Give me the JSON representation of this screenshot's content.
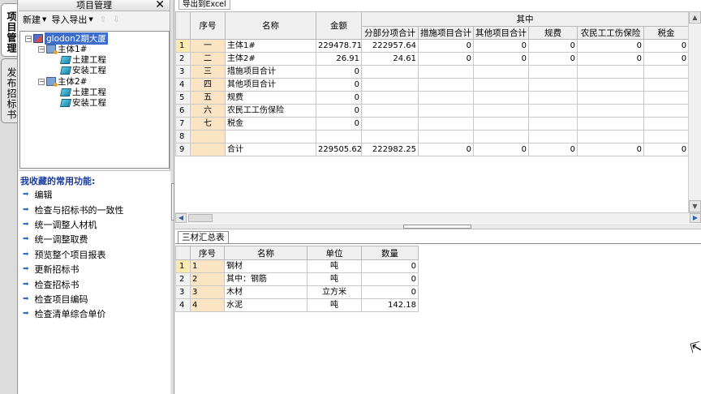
{
  "vertical_tabs": [
    "项目管理",
    "发布招标书"
  ],
  "left_panel": {
    "title": "项目管理",
    "close_glyph": "✕",
    "toolbar": {
      "new_label": "新建",
      "import_export_label": "导入导出",
      "up_glyph": "⇧",
      "down_glyph": "⇩"
    },
    "tree": {
      "root": "glodon2期大厦",
      "nodes": [
        {
          "label": "主体1#",
          "children": [
            "土建工程",
            "安装工程"
          ]
        },
        {
          "label": "主体2#",
          "children": [
            "土建工程",
            "安装工程"
          ]
        }
      ]
    },
    "favorites": {
      "title": "我收藏的常用功能:",
      "items": [
        "编辑",
        "检查与招标书的一致性",
        "统一调整人材机",
        "统一调整取费",
        "预览整个项目报表",
        "更新招标书",
        "检查招标书",
        "检查项目编码",
        "检查清单综合单价"
      ]
    }
  },
  "main": {
    "export_tab": "导出到Excel",
    "headers": {
      "seq": "序号",
      "name": "名称",
      "amount": "金额",
      "group": "其中",
      "sub": [
        "分部分项合计",
        "措施项目合计",
        "其他项目合计",
        "规费",
        "农民工工伤保险",
        "税金"
      ]
    },
    "rows": [
      {
        "n": "1",
        "seq": "一",
        "name": "主体1#",
        "amount": "229478.71",
        "sub": [
          "222957.64",
          "0",
          "0",
          "0",
          "0",
          "0"
        ]
      },
      {
        "n": "2",
        "seq": "二",
        "name": "主体2#",
        "amount": "26.91",
        "sub": [
          "24.61",
          "0",
          "0",
          "0",
          "0",
          "0"
        ]
      },
      {
        "n": "3",
        "seq": "三",
        "name": "措施项目合计",
        "amount": "0",
        "sub": [
          "",
          "",
          "",
          "",
          "",
          ""
        ]
      },
      {
        "n": "4",
        "seq": "四",
        "name": "其他项目合计",
        "amount": "0",
        "sub": [
          "",
          "",
          "",
          "",
          "",
          ""
        ]
      },
      {
        "n": "5",
        "seq": "五",
        "name": "规费",
        "amount": "0",
        "sub": [
          "",
          "",
          "",
          "",
          "",
          ""
        ]
      },
      {
        "n": "6",
        "seq": "六",
        "name": "农民工工伤保险",
        "amount": "0",
        "sub": [
          "",
          "",
          "",
          "",
          "",
          ""
        ]
      },
      {
        "n": "7",
        "seq": "七",
        "name": "税金",
        "amount": "0",
        "sub": [
          "",
          "",
          "",
          "",
          "",
          ""
        ]
      },
      {
        "n": "8",
        "seq": "",
        "name": "",
        "amount": "",
        "sub": [
          "",
          "",
          "",
          "",
          "",
          ""
        ]
      },
      {
        "n": "9",
        "seq": "",
        "name": "合计",
        "amount": "229505.62",
        "sub": [
          "222982.25",
          "0",
          "0",
          "0",
          "0",
          "0"
        ]
      }
    ]
  },
  "materials": {
    "tab": "三材汇总表",
    "headers": {
      "seq": "序号",
      "name": "名称",
      "unit": "单位",
      "qty": "数量"
    },
    "rows": [
      {
        "n": "1",
        "seq": "1",
        "name": "钢材",
        "unit": "吨",
        "qty": "0"
      },
      {
        "n": "2",
        "seq": "2",
        "name": "其中：钢筋",
        "unit": "吨",
        "qty": "0"
      },
      {
        "n": "3",
        "seq": "3",
        "name": "木材",
        "unit": "立方米",
        "qty": "0"
      },
      {
        "n": "4",
        "seq": "4",
        "name": "水泥",
        "unit": "吨",
        "qty": "142.18"
      }
    ]
  },
  "colors": {
    "highlight": "#fbe4c4",
    "selection": "#3d6dcc",
    "favorites_title": "#1a3c9c"
  }
}
